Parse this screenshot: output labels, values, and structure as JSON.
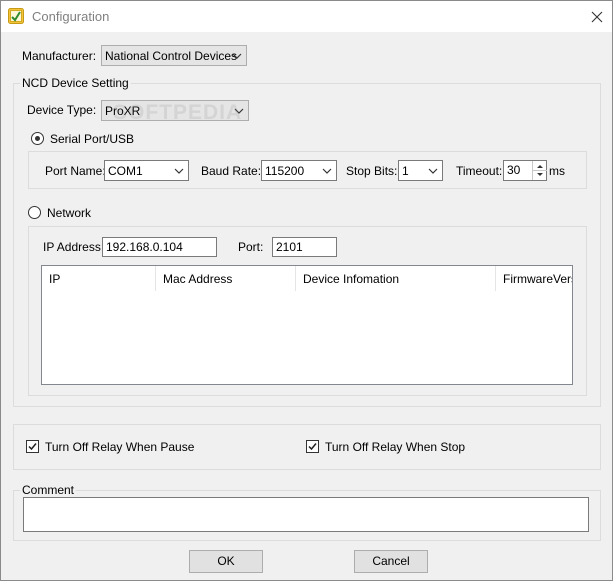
{
  "window": {
    "title": "Configuration",
    "close_glyph": "✕"
  },
  "manufacturer": {
    "label": "Manufacturer:",
    "value": "National Control Devices"
  },
  "ncd_group": {
    "title": "NCD Device Setting",
    "device_type_label": "Device Type:",
    "device_type_value": "ProXR",
    "watermark": "SOFTPEDIA"
  },
  "serial": {
    "radio_label": "Serial Port/USB",
    "selected": true,
    "port_name_label": "Port Name:",
    "port_name_value": "COM1",
    "baud_rate_label": "Baud Rate:",
    "baud_rate_value": "115200",
    "stop_bits_label": "Stop Bits:",
    "stop_bits_value": "1",
    "timeout_label": "Timeout:",
    "timeout_value": "30",
    "timeout_unit": "ms"
  },
  "network": {
    "radio_label": "Network",
    "selected": false,
    "ip_label": "IP Address:",
    "ip_value": "192.168.0.104",
    "port_label": "Port:",
    "port_value": "2101",
    "columns": [
      "IP",
      "Mac Address",
      "Device Infomation",
      "FirmwareVersic"
    ]
  },
  "relay": {
    "pause_label": "Turn Off Relay When Pause",
    "pause_checked": true,
    "stop_label": "Turn Off Relay When Stop",
    "stop_checked": true
  },
  "comment": {
    "label": "Comment",
    "value": ""
  },
  "buttons": {
    "ok": "OK",
    "cancel": "Cancel"
  }
}
